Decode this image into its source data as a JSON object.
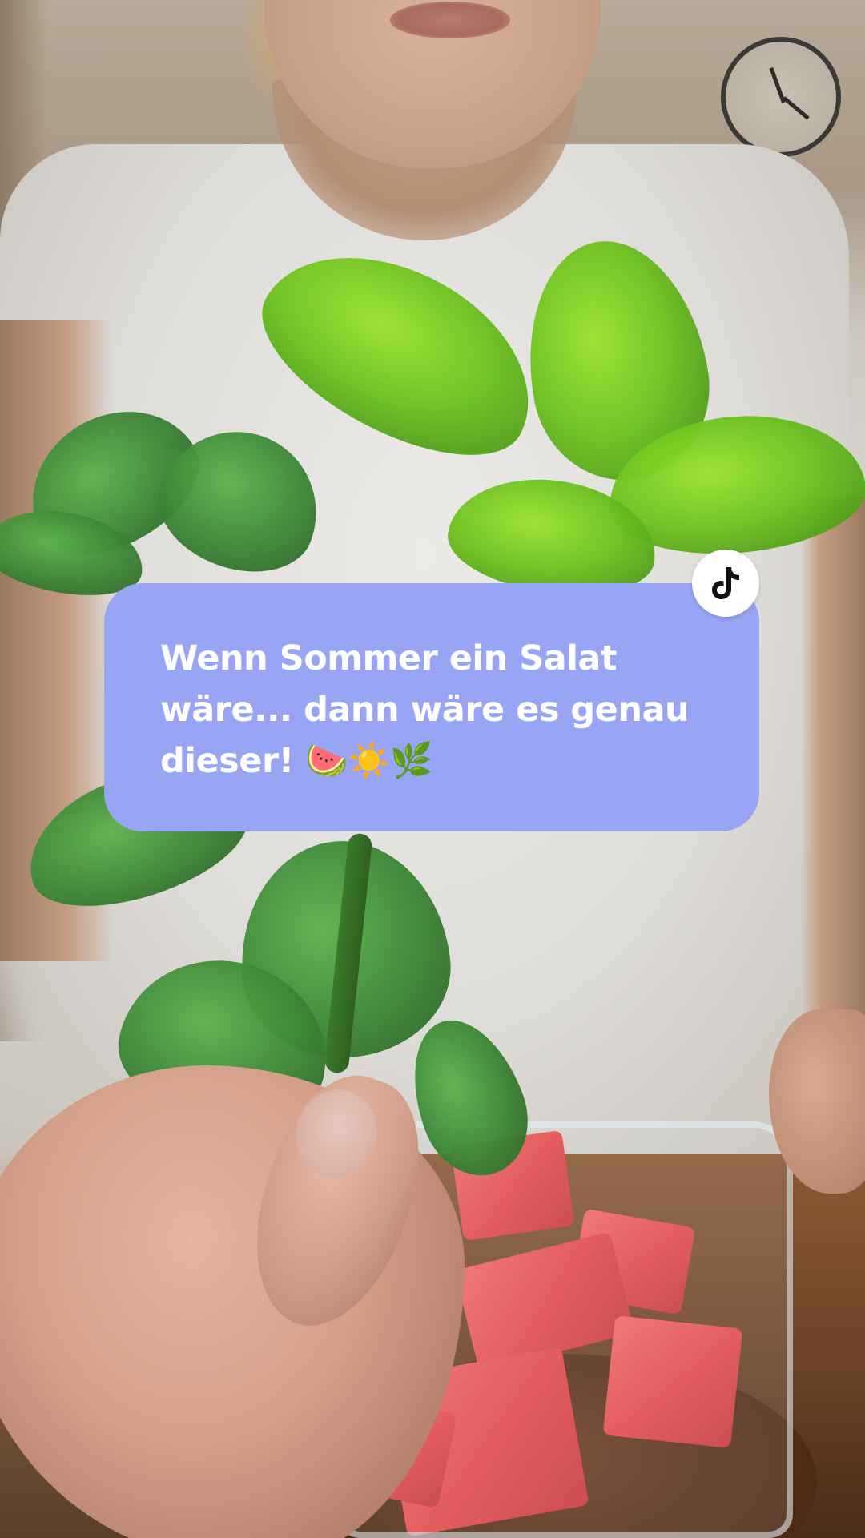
{
  "caption": {
    "text": "Wenn Sommer ein Salat\nwäre... dann wäre es genau\ndieser! 🍉☀️🌿",
    "background_color": "#98a5f5",
    "text_color": "#ffffff"
  },
  "badge": {
    "icon": "tiktok-logo-icon"
  },
  "scene": {
    "description_items": [
      "mint-sprig",
      "watermelon-bowl",
      "hand",
      "wall-clock"
    ]
  }
}
